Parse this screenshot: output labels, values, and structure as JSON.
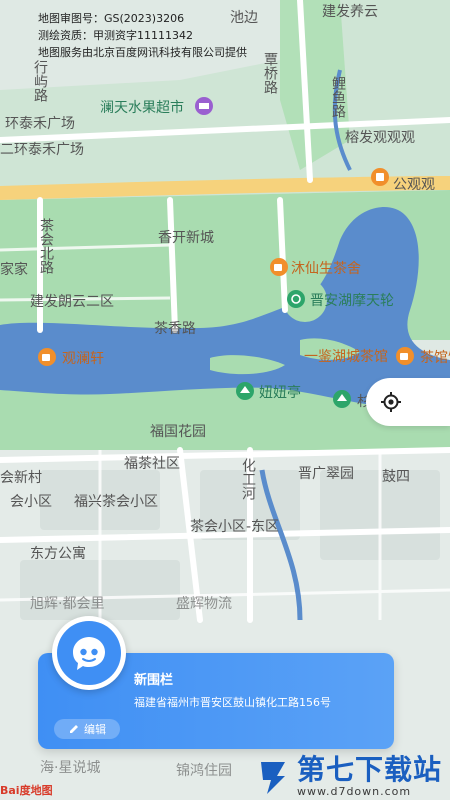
{
  "copyright": {
    "line1": "地图审图号：GS(2023)3206",
    "line2": "测绘资质：甲测资字11111342",
    "line3": "地图服务由北京百度网讯科技有限公司提供"
  },
  "map_labels": {
    "chibian": "池边",
    "jianfa_yangyun": "建发养云",
    "tanqiao": "覃桥路",
    "li_meng": "鲤鱼路",
    "xing_lu": "行屿路",
    "lantian_market": "澜天水果超市",
    "huantai_plaza_1": "环泰禾广场",
    "huantai_plaza_2": "二环泰禾广场",
    "rongfa": "榕发观观观",
    "guanxian": "公观观",
    "xiangkai": "香开新城",
    "chahui_north": "茶会北路",
    "jia": "家家",
    "muxian_tea": "沐仙生茶舍",
    "jianfa_langyun": "建发朗云二区",
    "jinan_ferris": "晋安湖摩天轮",
    "chaxiang_road": "茶香路",
    "guanlan": "观澜轩",
    "yijian_tea": "一鉴湖城茶馆",
    "tea_house": "茶馆馆",
    "niuniu": "妞妞亭",
    "gu_hill": "杉",
    "fuguo_garden": "福国花园",
    "fucha_community": "福茶社区",
    "huahe": "化工河",
    "jinguang_cuiyuan": "晋广翠园",
    "guxi": "鼓四",
    "chahui_new_village": "会新村",
    "hui_community": "会小区",
    "fuxing_chahui": "福兴茶会小区",
    "chahui_east": "茶会小区-东区",
    "dongfang": "东方公寓",
    "xuhui": "旭辉·都会里",
    "shenghui": "盛辉物流",
    "haixing": "海·星说城",
    "jinhong": "锦鸿住园"
  },
  "card": {
    "title": "新围栏",
    "address": "福建省福州市晋安区鼓山镇化工路156号",
    "edit_label": "编辑"
  },
  "watermark": {
    "title": "第七下载站",
    "url": "www.d7down.com"
  },
  "baidu_logo": "Bai度地图",
  "icons": {
    "locate": "locate-icon",
    "edit": "edit-icon",
    "avatar": "face-icon",
    "shop": "shop-icon",
    "tea": "tea-cup-icon",
    "ferris": "ferris-wheel-icon",
    "pavilion": "pavilion-icon"
  },
  "colors": {
    "water": "#5a8ccc",
    "park": "#a9dcb0",
    "road": "#ffffff",
    "highway": "#f6d27c",
    "card": "#3f8ff4",
    "poi_orange": "#f18f2b",
    "poi_green": "#2da56a",
    "poi_purple": "#9a5fd0"
  }
}
